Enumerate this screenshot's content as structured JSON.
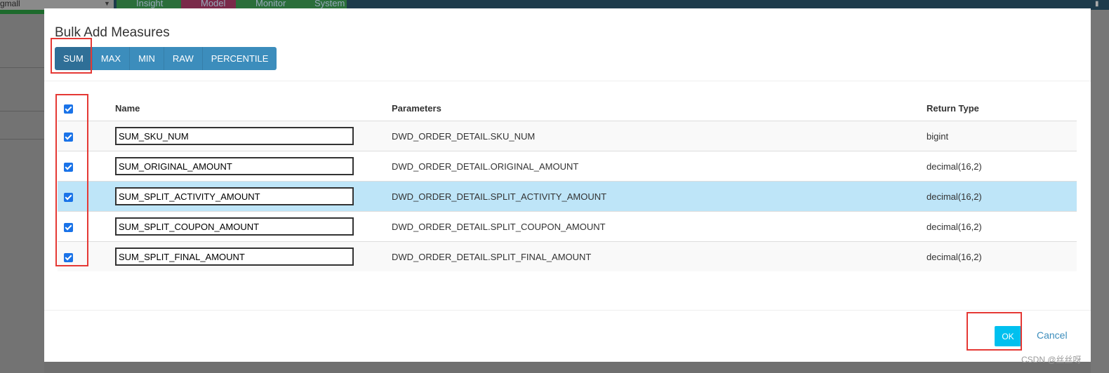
{
  "background_app": {
    "project": "gmall",
    "nav_tabs": [
      "Insight",
      "Model",
      "Monitor",
      "System"
    ],
    "nav_tab_colors": [
      "#2a6e3a",
      "#7a2a4a",
      "#2a6e3a",
      "#2a6e3a"
    ]
  },
  "modal": {
    "title": "Bulk Add Measures",
    "function_buttons": [
      {
        "label": "SUM",
        "active": true
      },
      {
        "label": "MAX",
        "active": false
      },
      {
        "label": "MIN",
        "active": false
      },
      {
        "label": "RAW",
        "active": false
      },
      {
        "label": "PERCENTILE",
        "active": false
      }
    ],
    "table": {
      "select_all_checked": true,
      "headers": {
        "name": "Name",
        "parameters": "Parameters",
        "return_type": "Return Type"
      },
      "rows": [
        {
          "checked": true,
          "name": "SUM_SKU_NUM",
          "parameters": "DWD_ORDER_DETAIL.SKU_NUM",
          "return_type": "bigint",
          "highlighted": false
        },
        {
          "checked": true,
          "name": "SUM_ORIGINAL_AMOUNT",
          "parameters": "DWD_ORDER_DETAIL.ORIGINAL_AMOUNT",
          "return_type": "decimal(16,2)",
          "highlighted": false
        },
        {
          "checked": true,
          "name": "SUM_SPLIT_ACTIVITY_AMOUNT",
          "parameters": "DWD_ORDER_DETAIL.SPLIT_ACTIVITY_AMOUNT",
          "return_type": "decimal(16,2)",
          "highlighted": true
        },
        {
          "checked": true,
          "name": "SUM_SPLIT_COUPON_AMOUNT",
          "parameters": "DWD_ORDER_DETAIL.SPLIT_COUPON_AMOUNT",
          "return_type": "decimal(16,2)",
          "highlighted": false
        },
        {
          "checked": true,
          "name": "SUM_SPLIT_FINAL_AMOUNT",
          "parameters": "DWD_ORDER_DETAIL.SPLIT_FINAL_AMOUNT",
          "return_type": "decimal(16,2)",
          "highlighted": false
        }
      ]
    },
    "ok_label": "OK",
    "cancel_label": "Cancel"
  },
  "watermark": "CSDN @丝丝呀",
  "colors": {
    "primary": "#3c8dbc",
    "ok": "#00c0ef",
    "highlight_row": "#bee5f8",
    "annotation": "#e53935"
  }
}
